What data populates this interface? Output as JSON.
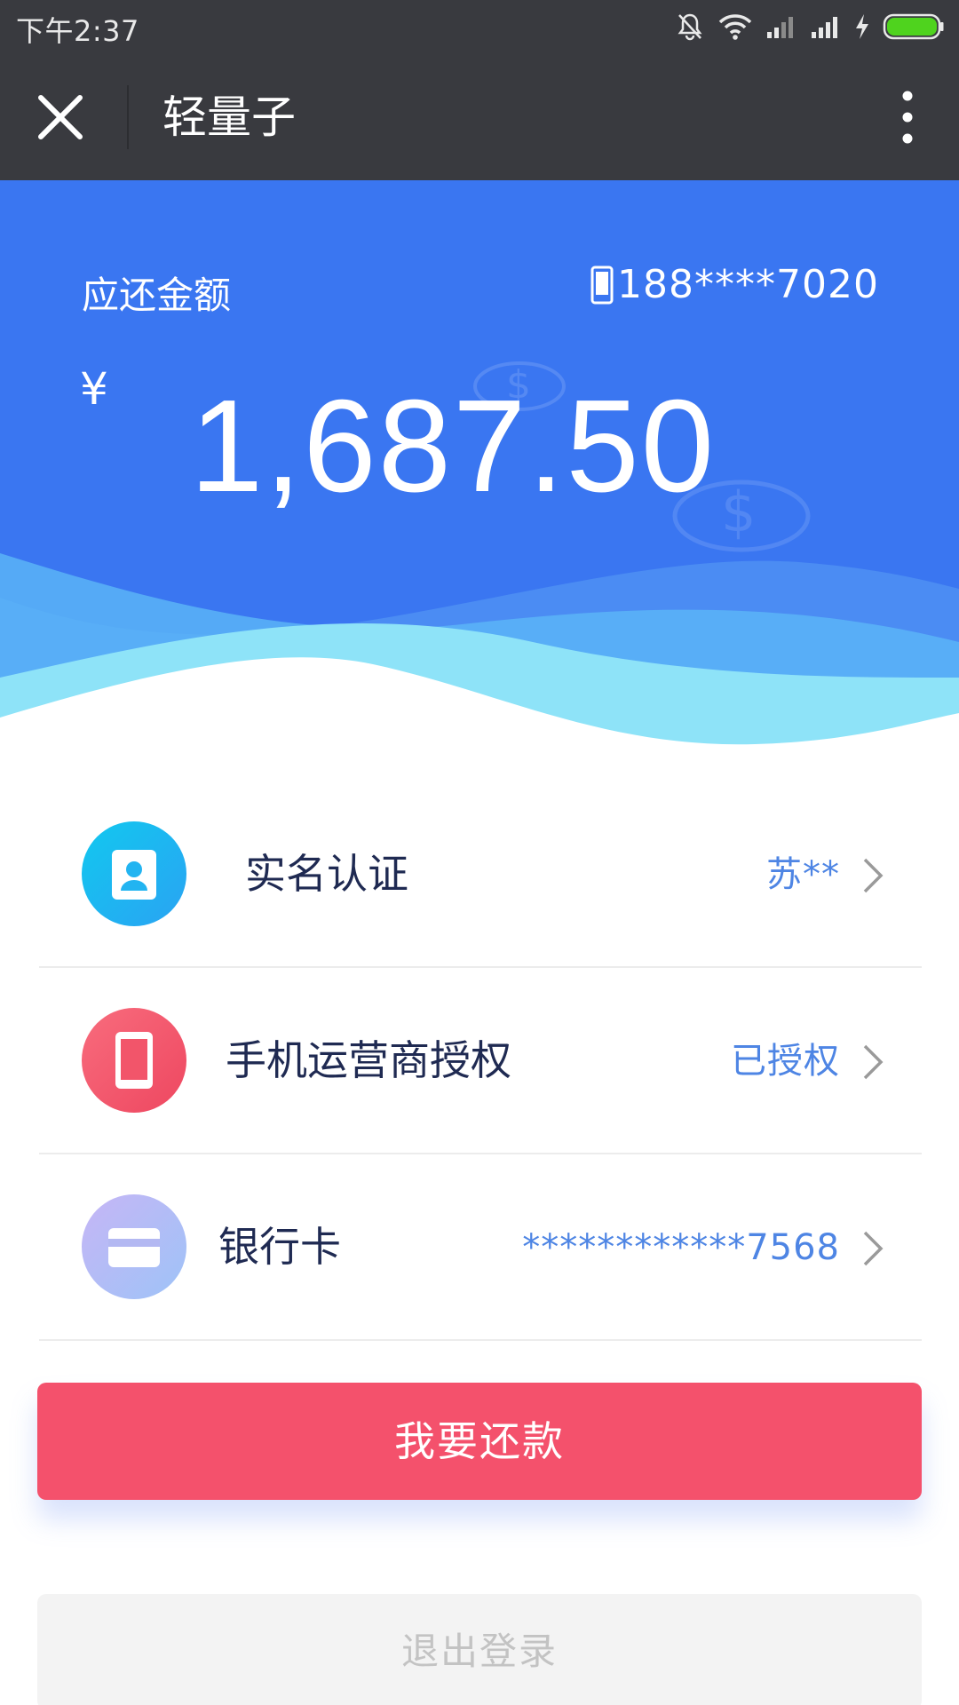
{
  "status_bar": {
    "time": "下午2:37",
    "icons": [
      "bell-muted-icon",
      "wifi-icon",
      "signal-icon",
      "signal-icon",
      "charging-icon",
      "battery-icon"
    ]
  },
  "nav": {
    "title": "轻量子",
    "close_icon": "close-icon",
    "more_icon": "more-vertical-icon"
  },
  "banner": {
    "amount_label": "应还金额",
    "phone_number": "188****7020",
    "currency": "¥",
    "amount": "1,687.50",
    "colors": {
      "background": "#3a76f1",
      "wave_light": "#8ee3f8",
      "wave_mid": "#5ab4f7"
    }
  },
  "list": {
    "items": [
      {
        "label": "实名认证",
        "value": "苏**",
        "icon": "id-card-icon",
        "icon_color": "#1fb5f0"
      },
      {
        "label": "手机运营商授权",
        "value": "已授权",
        "icon": "mobile-phone-icon",
        "icon_color": "#f2556a"
      },
      {
        "label": "银行卡",
        "value": "************7568",
        "icon": "bank-card-icon",
        "icon_color": "#aab6f4"
      }
    ]
  },
  "actions": {
    "repay_label": "我要还款",
    "logout_label": "退出登录",
    "repay_color": "#f4516c"
  }
}
